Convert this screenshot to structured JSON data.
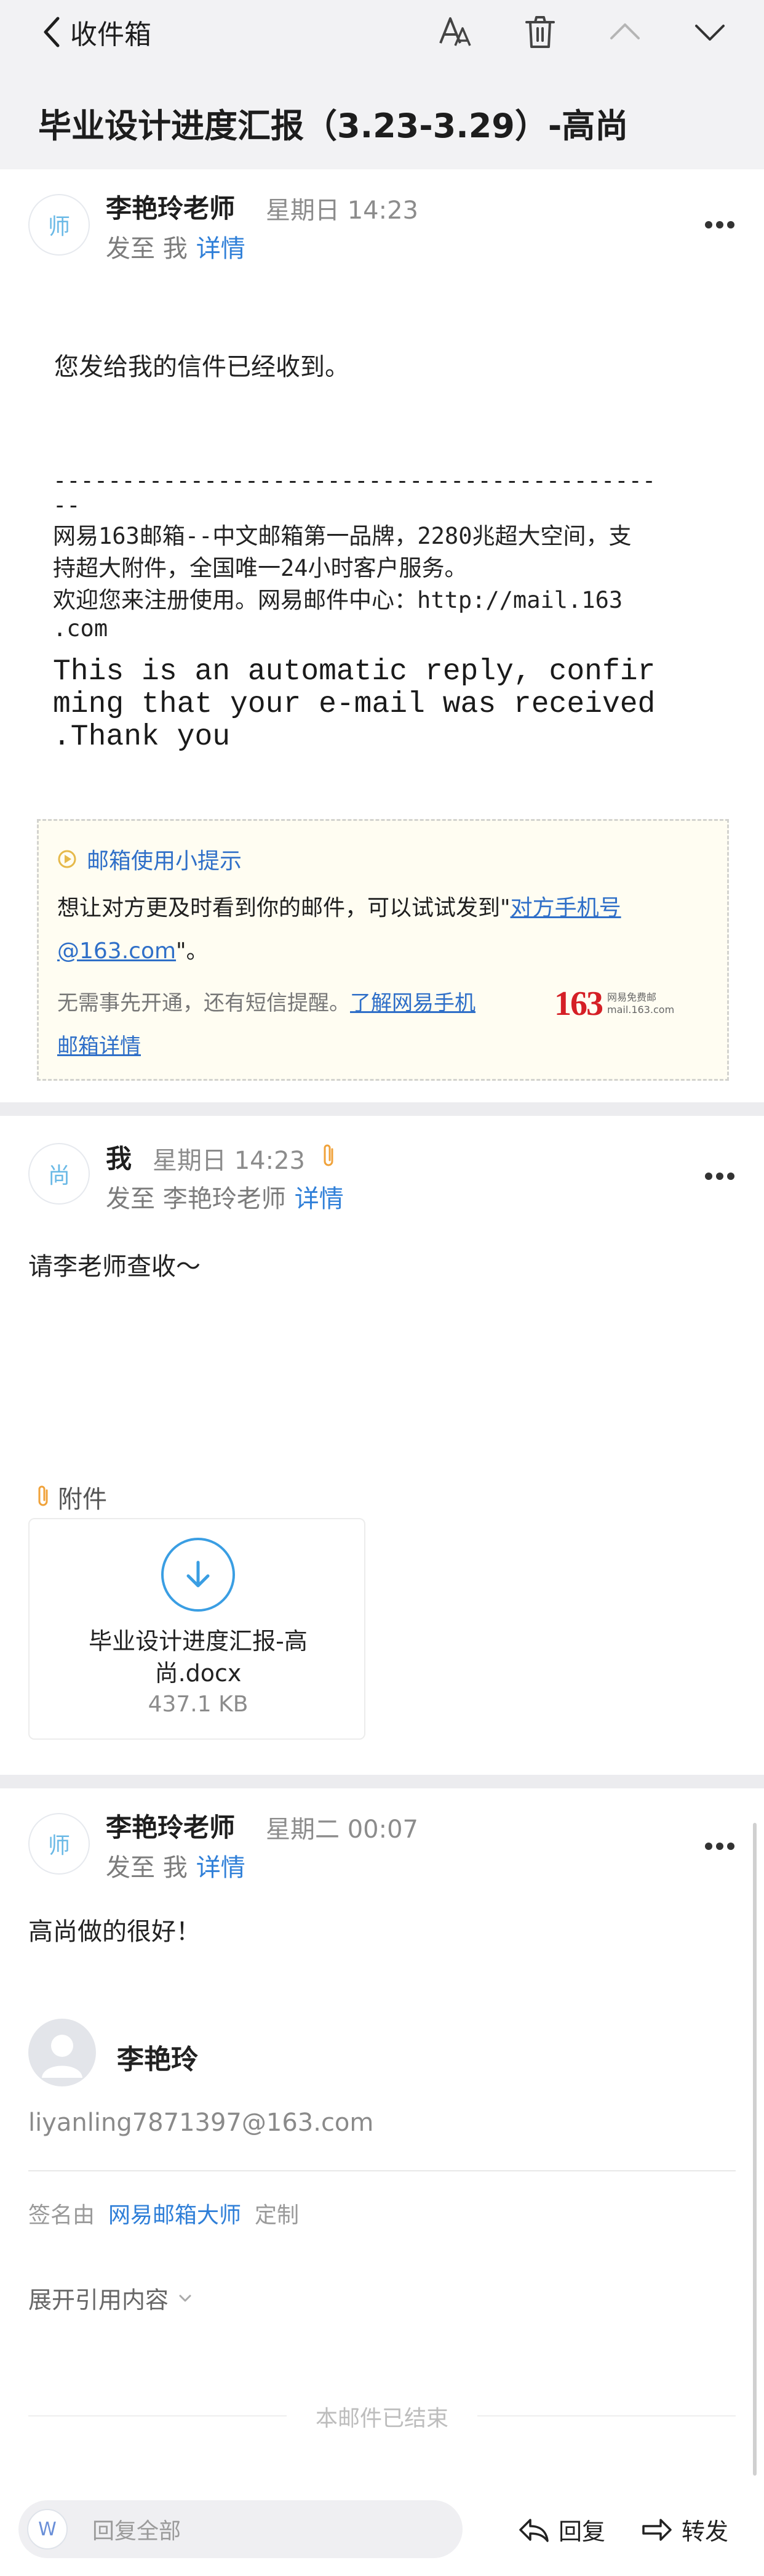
{
  "header": {
    "back_label": "收件箱",
    "subject": "毕业设计进度汇报（3.23-3.29）-高尚"
  },
  "messages": [
    {
      "avatar_char": "师",
      "sender": "李艳玲老师",
      "time": "星期日 14:23",
      "to_prefix": "发至 我",
      "detail": "详情",
      "body_line": "您发给我的信件已经收到。",
      "dash_line_1": "--------------------------------------------",
      "dash_line_2": "--",
      "promo_1": "网易163邮箱--中文邮箱第一品牌，2280兆超大空间，支",
      "promo_2": "持超大附件，全国唯一24小时客户服务。",
      "promo_3": "欢迎您来注册使用。网易邮件中心：http://mail.163",
      "promo_4": ".com",
      "auto_1": "This is an automatic reply, confir",
      "auto_2": "ming that your e-mail was received",
      "auto_3": ".Thank you",
      "tip": {
        "title": "邮箱使用小提示",
        "line1_pre": "想让对方更及时看到你的邮件，可以试试发到\"",
        "line1_link": "对方手机号",
        "line2_link": "@163.com",
        "line2_post": "\"。",
        "line3_pre": "无需事先开通，还有短信提醒。",
        "line3_link": "了解网易手机",
        "line4_link": "邮箱详情",
        "logo_num": "163",
        "logo_txt1": "网易免费邮",
        "logo_txt2": "mail.163.com"
      }
    },
    {
      "avatar_char": "尚",
      "sender": "我",
      "time": "星期日 14:23",
      "to_prefix": "发至 李艳玲老师",
      "detail": "详情",
      "body_line": "请李老师查收～",
      "attach_label": "附件",
      "attachment": {
        "name_1": "毕业设计进度汇报-高",
        "name_2": "尚.docx",
        "size": "437.1 KB"
      }
    },
    {
      "avatar_char": "师",
      "sender": "李艳玲老师",
      "time": "星期二 00:07",
      "to_prefix": "发至 我",
      "detail": "详情",
      "body_line": "高尚做的很好！",
      "sig_name": "李艳玲",
      "sig_email": "liyanling7871397@163.com",
      "signed_by": "签名由",
      "signed_app": "网易邮箱大师",
      "signed_custom": "定制",
      "expand_quote": "展开引用内容",
      "end_note": "本邮件已结束"
    }
  ],
  "bottom": {
    "avatar_char": "W",
    "reply_all_placeholder": "回复全部",
    "reply": "回复",
    "forward": "转发"
  },
  "colors": {
    "link_blue": "#2f7fd8",
    "avatar_text": "#6ab9e6",
    "brand_red": "#d51f26",
    "attachment_clip": "#f0a23a",
    "download_blue": "#3a9ee3"
  }
}
